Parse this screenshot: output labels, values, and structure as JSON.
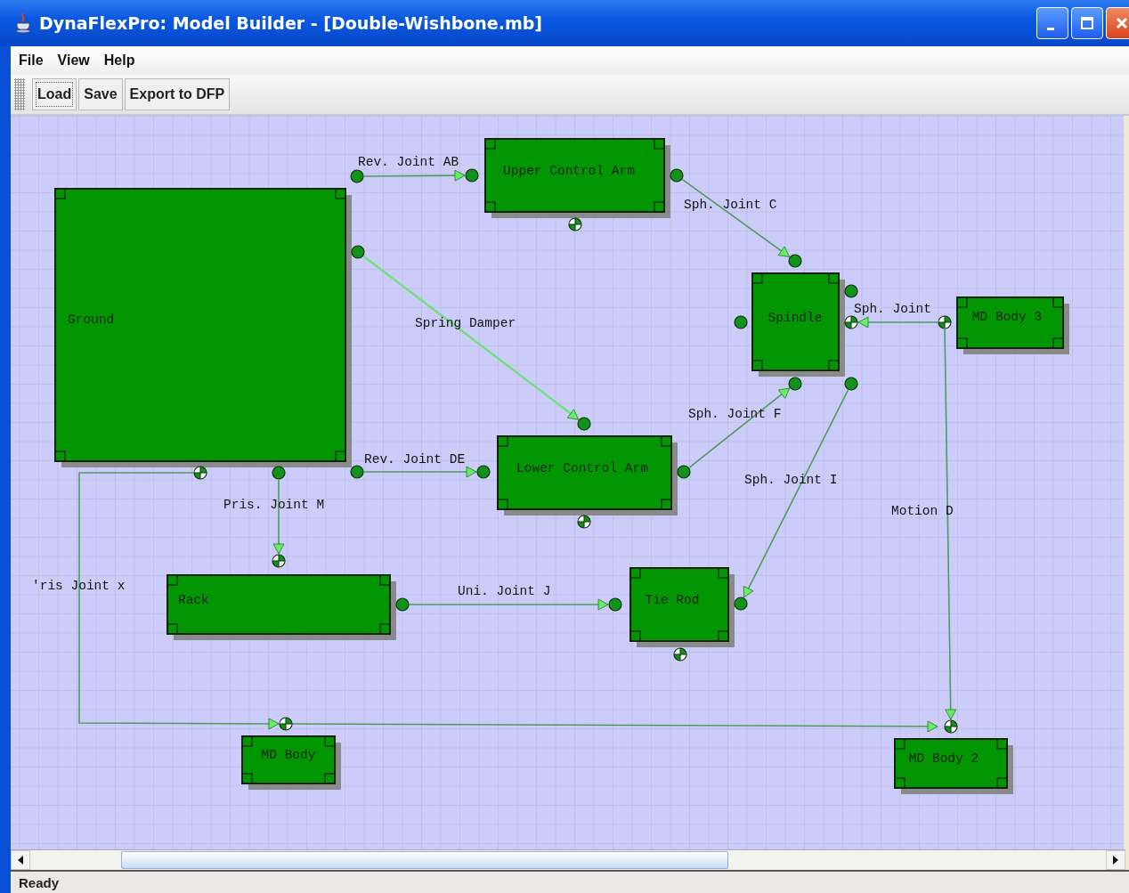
{
  "window": {
    "title": "DynaFlexPro: Model Builder - [Double-Wishbone.mb]"
  },
  "menu": [
    "File",
    "View",
    "Help"
  ],
  "toolbar": [
    {
      "label": "Load",
      "focused": true
    },
    {
      "label": "Save",
      "focused": false
    },
    {
      "label": "Export to DFP",
      "focused": false
    }
  ],
  "diagram": {
    "bodies": [
      {
        "label": "Ground"
      },
      {
        "label": "Upper Control Arm"
      },
      {
        "label": "Spindle"
      },
      {
        "label": "MD Body 3"
      },
      {
        "label": "Lower Control Arm"
      },
      {
        "label": "Rack"
      },
      {
        "label": "Tie Rod"
      },
      {
        "label": "MD Body"
      },
      {
        "label": "MD Body 2"
      }
    ],
    "joints": [
      {
        "label": "Rev. Joint AB",
        "kind": "joint"
      },
      {
        "label": "Sph. Joint C",
        "kind": "joint"
      },
      {
        "label": "Spring Damper",
        "kind": "spring"
      },
      {
        "label": "Sph. Joint",
        "kind": "joint"
      },
      {
        "label": "Sph. Joint F",
        "kind": "joint"
      },
      {
        "label": "Rev. Joint DE",
        "kind": "joint"
      },
      {
        "label": "Sph. Joint I",
        "kind": "joint"
      },
      {
        "label": "Pris. Joint M",
        "kind": "joint"
      },
      {
        "label": "Motion D",
        "kind": "joint"
      },
      {
        "label": "'ris Joint x",
        "kind": "joint"
      },
      {
        "label": "Uni. Joint J",
        "kind": "joint"
      }
    ]
  },
  "status_bar": "Ready"
}
